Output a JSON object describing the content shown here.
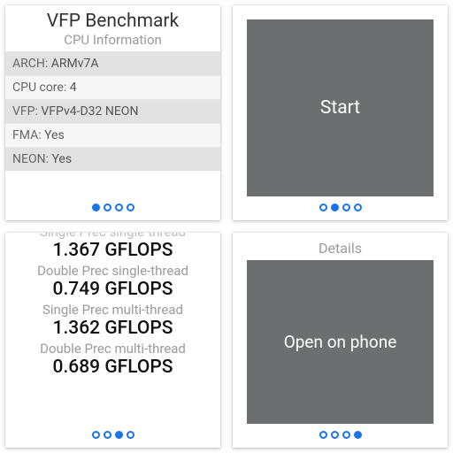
{
  "card1": {
    "title": "VFP Benchmark",
    "subtitle": "CPU Information",
    "rows": [
      {
        "k": "ARCH:",
        "v": "ARMv7A"
      },
      {
        "k": "CPU core:",
        "v": "4"
      },
      {
        "k": "VFP:",
        "v": "VFPv4-D32 NEON"
      },
      {
        "k": "FMA:",
        "v": "Yes"
      },
      {
        "k": "NEON:",
        "v": "Yes"
      }
    ],
    "active_dot": 0,
    "dot_count": 4
  },
  "card2": {
    "button_label": "Start",
    "active_dot": 1,
    "dot_count": 4
  },
  "card3": {
    "results": [
      {
        "label": "Single Prec single-thread",
        "value": "1.367 GFLOPS"
      },
      {
        "label": "Double Prec single-thread",
        "value": "0.749 GFLOPS"
      },
      {
        "label": "Single Prec multi-thread",
        "value": "1.362 GFLOPS"
      },
      {
        "label": "Double Prec multi-thread",
        "value": "0.689 GFLOPS"
      }
    ],
    "active_dot": 2,
    "dot_count": 4
  },
  "card4": {
    "title": "Details",
    "button_label": "Open on phone",
    "active_dot": 3,
    "dot_count": 4
  }
}
